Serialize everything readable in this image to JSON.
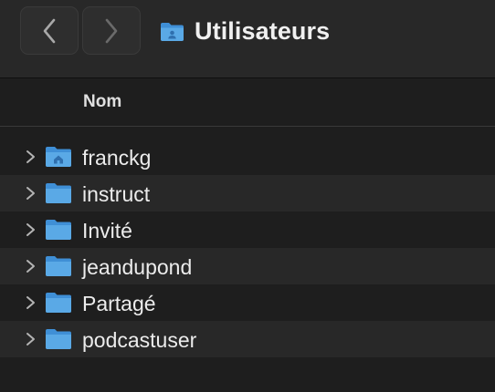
{
  "toolbar": {
    "back_icon": "chevron-left-icon",
    "forward_icon": "chevron-right-icon",
    "title": "Utilisateurs",
    "title_icon": "users-folder-icon"
  },
  "columns": {
    "name": "Nom"
  },
  "rows": [
    {
      "label": "franckg",
      "icon": "home-folder-icon"
    },
    {
      "label": "instruct",
      "icon": "folder-icon"
    },
    {
      "label": "Invité",
      "icon": "folder-icon"
    },
    {
      "label": "jeandupond",
      "icon": "folder-icon"
    },
    {
      "label": "Partagé",
      "icon": "folder-icon"
    },
    {
      "label": "podcastuser",
      "icon": "folder-icon"
    }
  ],
  "colors": {
    "background": "#1e1e1e",
    "toolbar": "#282828",
    "alt_row": "#282828",
    "folder_blue": "#5aa9e6"
  }
}
